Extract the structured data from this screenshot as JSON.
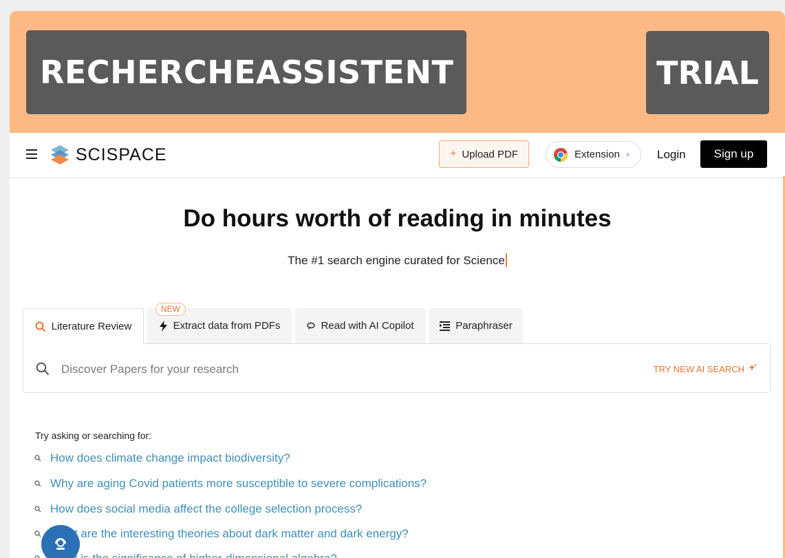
{
  "banner": {
    "left_text": "RECHERCHEASSISTENT",
    "right_text": "TRIAL"
  },
  "navbar": {
    "brand": "SCISPACE",
    "upload_label": "Upload PDF",
    "upload_plus": "+",
    "extension_label": "Extension",
    "extension_plus": "+",
    "login_label": "Login",
    "signup_label": "Sign up"
  },
  "hero": {
    "title": "Do hours worth of reading in minutes",
    "subtitle": "The #1 search engine curated for Science"
  },
  "tabs": [
    {
      "label": "Literature Review",
      "icon": "search-icon",
      "active": true
    },
    {
      "label": "Extract data from PDFs",
      "icon": "lightning-icon",
      "active": false,
      "badge": "NEW"
    },
    {
      "label": "Read with AI Copilot",
      "icon": "chat-bubble-icon",
      "active": false
    },
    {
      "label": "Paraphraser",
      "icon": "paraphrase-icon",
      "active": false
    }
  ],
  "search": {
    "placeholder": "Discover Papers for your research",
    "ai_search_label": "TRY NEW AI SEARCH"
  },
  "suggestions": {
    "title": "Try asking or searching for:",
    "items": [
      "How does climate change impact biodiversity?",
      "Why are aging Covid patients more susceptible to severe complications?",
      "How does social media affect the college selection process?",
      "What are the interesting theories about dark matter and dark energy?",
      "What is the significance of higher-dimensional algebra?"
    ]
  },
  "colors": {
    "banner_bg": "#fdb985",
    "banner_box": "#5a5a5a",
    "accent_orange": "#e8752e",
    "link_blue": "#3f8fb8",
    "fab_blue": "#2b6fb5"
  }
}
